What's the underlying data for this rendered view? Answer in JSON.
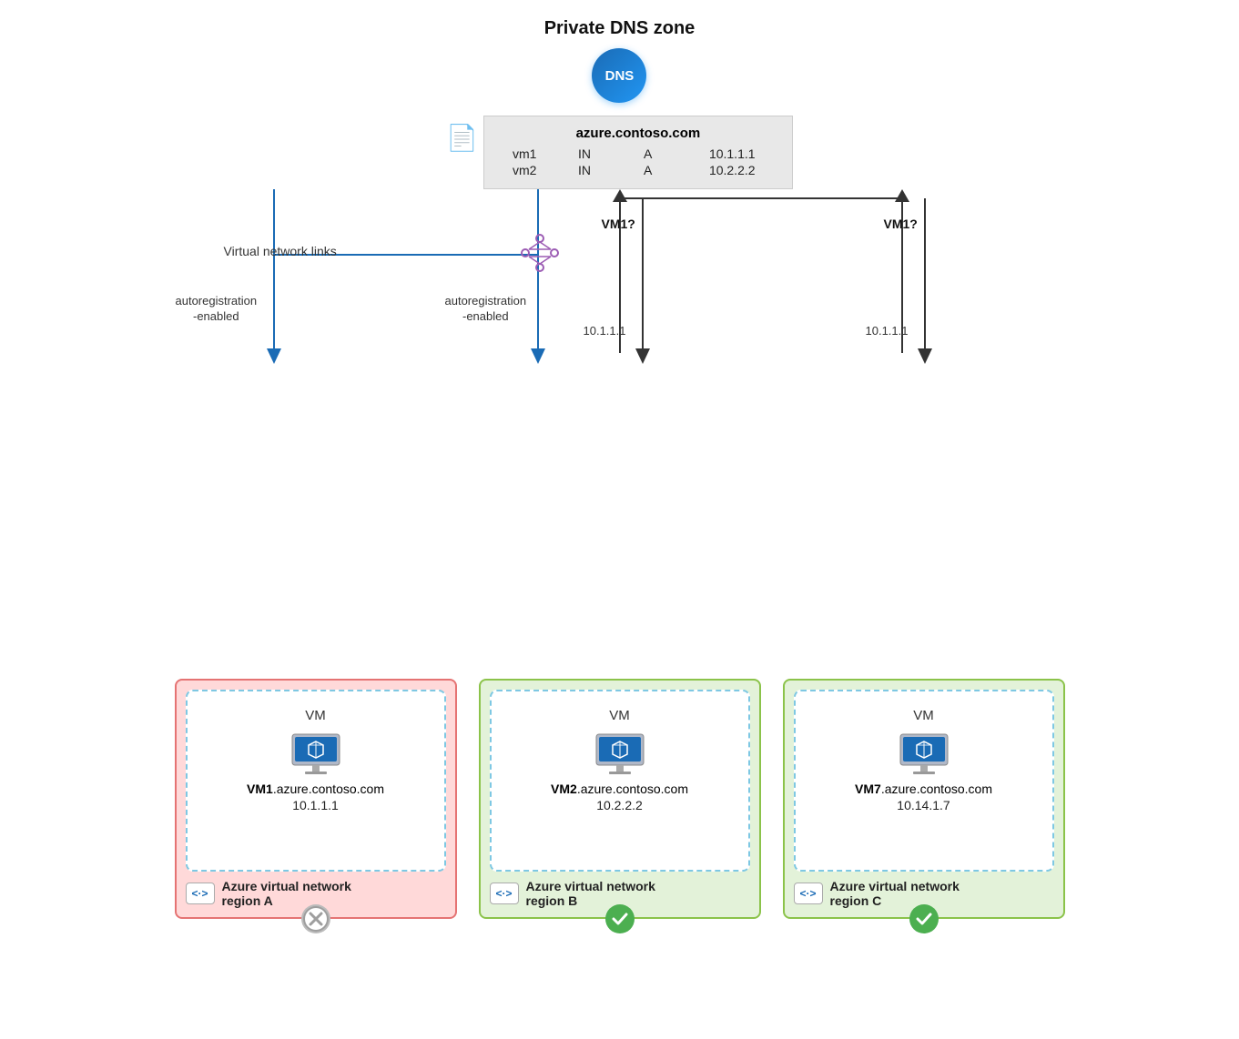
{
  "diagram": {
    "title": "Private DNS zone",
    "dns_icon_label": "DNS",
    "dns_domain": "azure.contoso.com",
    "dns_records": [
      {
        "name": "vm1",
        "class": "IN",
        "type": "A",
        "ip": "10.1.1.1"
      },
      {
        "name": "vm2",
        "class": "IN",
        "type": "A",
        "ip": "10.2.2.2"
      }
    ],
    "vnet_links_label": "Virtual network links",
    "autoregistration_labels": [
      "autoregistration\n-enabled",
      "autoregistration\n-enabled"
    ],
    "query_labels": [
      "VM1?",
      "VM1?"
    ],
    "ip_response_labels": [
      "10.1.1.1",
      "10.1.1.1"
    ],
    "regions": [
      {
        "id": "region-a",
        "color": "red",
        "vm_label": "VM",
        "vm_hostname_bold": "VM1",
        "vm_hostname_rest": ".azure.contoso.com",
        "vm_ip": "10.1.1.1",
        "region_name": "Azure virtual network\nregion A",
        "region_icon": "<·>",
        "status": "error"
      },
      {
        "id": "region-b",
        "color": "green",
        "vm_label": "VM",
        "vm_hostname_bold": "VM2",
        "vm_hostname_rest": ".azure.contoso.com",
        "vm_ip": "10.2.2.2",
        "region_name": "Azure virtual network\nregion B",
        "region_icon": "<·>",
        "status": "success"
      },
      {
        "id": "region-c",
        "color": "green",
        "vm_label": "VM",
        "vm_hostname_bold": "VM7",
        "vm_hostname_rest": ".azure.contoso.com",
        "vm_ip": "10.14.1.7",
        "region_name": "Azure virtual network\nregion C",
        "region_icon": "<·>",
        "status": "success"
      }
    ]
  }
}
